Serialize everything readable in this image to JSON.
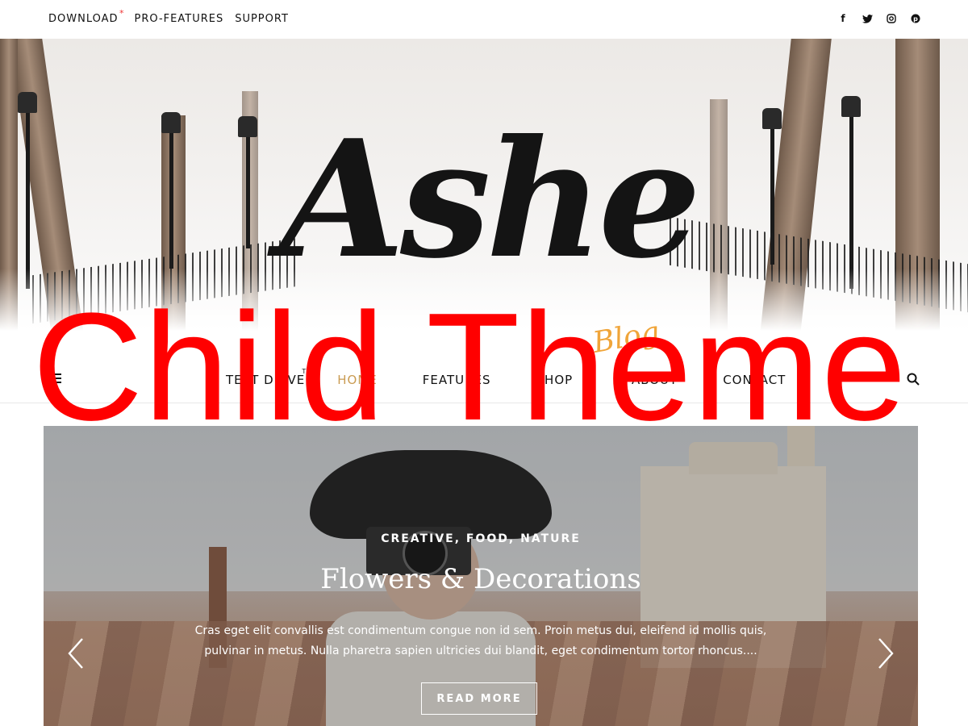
{
  "top_menu": {
    "download": "DOWNLOAD",
    "star": "*",
    "pro": "PRO-FEATURES",
    "support": "SUPPORT"
  },
  "social": {
    "facebook": "f",
    "twitter": "t",
    "instagram": "◎",
    "pinterest": "p"
  },
  "logo": {
    "title": "Ashe",
    "subtitle": "Blog"
  },
  "overlay": {
    "text": "Child Theme"
  },
  "main_nav": {
    "items": [
      {
        "label": "TEST DRIVE",
        "sup": "TRY"
      },
      {
        "label": "HOME"
      },
      {
        "label": "FEATURES"
      },
      {
        "label": "SHOP"
      },
      {
        "label": "ABOUT"
      },
      {
        "label": "CONTACT"
      }
    ]
  },
  "slider": {
    "category": "CREATIVE, FOOD, NATURE",
    "title": "Flowers & Decorations",
    "excerpt": "Cras eget elit convallis est condimentum congue non id sem. Proin metus dui, eleifend id mollis quis, pulvinar in metus. Nulla pharetra sapien ultricies dui blandit, eget condimentum tortor rhoncus....",
    "button": "READ MORE"
  },
  "colors": {
    "accent": "#ca9b52",
    "overlay_red": "#ff0000",
    "logo_sub": "#f0a53a"
  }
}
